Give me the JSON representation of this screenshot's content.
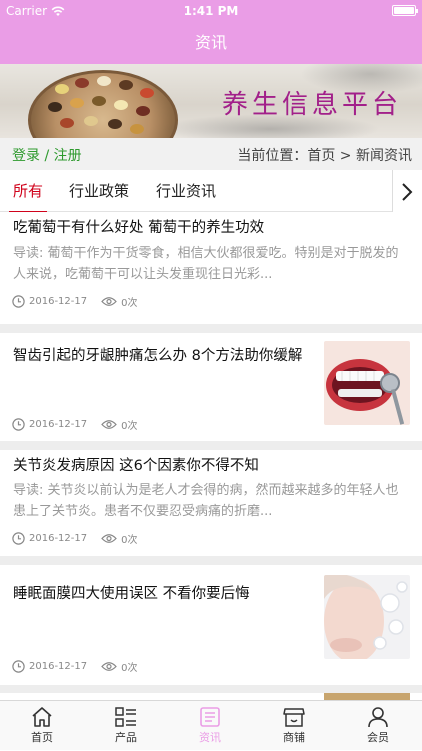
{
  "status_bar": {
    "carrier": "Carrier",
    "time": "1:41 PM"
  },
  "nav": {
    "title": "资讯"
  },
  "banner": {
    "title": "养生信息平台"
  },
  "crumb": {
    "login": "登录 / 注册",
    "location": "当前位置：首页 > 新闻资讯"
  },
  "tabs": [
    {
      "label": "所有",
      "active": true
    },
    {
      "label": "行业政策"
    },
    {
      "label": "行业资讯"
    }
  ],
  "articles": [
    {
      "title": "吃葡萄干有什么好处 葡萄干的养生功效",
      "summary": "导读: 葡萄干作为干货零食，相信大伙都很爱吃。特别是对于脱发的人来说，吃葡萄干可以让头发重现往日光彩...",
      "date": "2016-12-17",
      "views": "0次"
    },
    {
      "title": "智齿引起的牙龈肿痛怎么办 8个方法助你缓解",
      "date": "2016-12-17",
      "views": "0次"
    },
    {
      "title": "关节炎发病原因 这6个因素你不得不知",
      "summary": "导读: 关节炎以前认为是老人才会得的病，然而越来越多的年轻人也患上了关节炎。患者不仅要忍受病痛的折磨...",
      "date": "2016-12-17",
      "views": "0次"
    },
    {
      "title": "睡眠面膜四大使用误区 不看你要后悔",
      "date": "2016-12-17",
      "views": "0次"
    }
  ],
  "tabbar": [
    {
      "label": "首页",
      "icon": "home-icon"
    },
    {
      "label": "产品",
      "icon": "product-icon"
    },
    {
      "label": "资讯",
      "icon": "news-icon",
      "active": true
    },
    {
      "label": "商铺",
      "icon": "shop-icon"
    },
    {
      "label": "会员",
      "icon": "member-icon"
    }
  ],
  "colors": {
    "accent": "#ea9de6",
    "active_tab": "#d0021b",
    "login_link": "#2e9a2e",
    "banner_title": "#a2208a"
  }
}
